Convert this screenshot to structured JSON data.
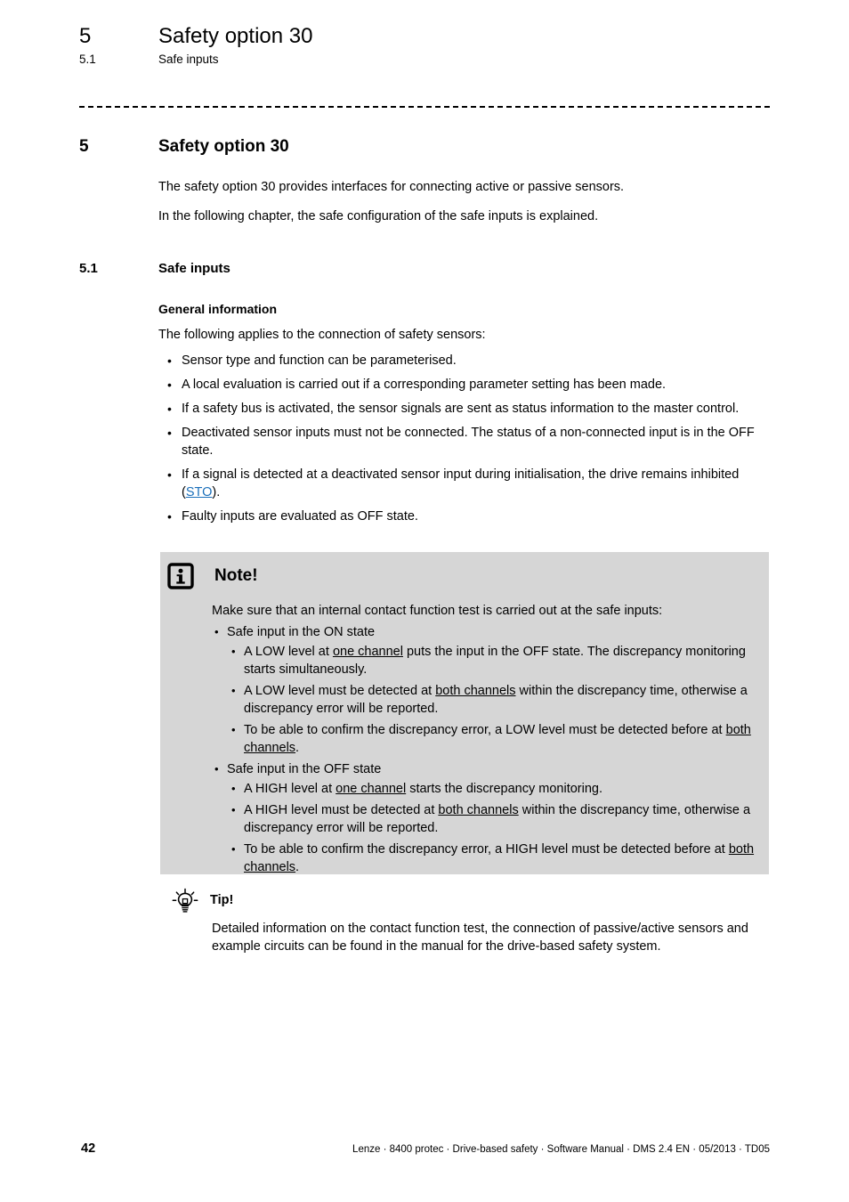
{
  "running_header": {
    "chapter_number": "5",
    "chapter_title": "Safety option 30",
    "section_number": "5.1",
    "section_title": "Safe inputs"
  },
  "chapter": {
    "number": "5",
    "title": "Safety option 30",
    "intro_paragraph_1": "The safety option 30 provides interfaces for connecting active or passive sensors.",
    "intro_paragraph_2": "In the following chapter, the safe configuration of the safe inputs is explained."
  },
  "section": {
    "number": "5.1",
    "title": "Safe inputs"
  },
  "general_information": {
    "title": "General information",
    "lead": "The following applies to the connection of safety sensors:",
    "bullets": [
      "Sensor type and function can be parameterised.",
      "A local evaluation is carried out if a corresponding parameter setting has been made.",
      "If a safety bus is activated, the sensor signals are sent as status information to the master control.",
      "Deactivated sensor inputs must not be connected. The status of a non-connected input is in the OFF state.",
      "Faulty inputs are evaluated as OFF state.",
      "If a signal is detected at a deactivated sensor input during initialisation, the drive remains inhibited ("
    ],
    "sto_bullet": {
      "text_before": "If a signal is detected at a deactivated sensor input during initialisation, the drive remains inhibited (",
      "link_label": "STO",
      "text_after": ")."
    }
  },
  "note": {
    "icon": "info-icon",
    "title": "Note!",
    "lead": "Make sure that an internal contact function test is carried out at the safe inputs:",
    "groups": [
      {
        "label": "Safe input in the ON state",
        "items": [
          {
            "prefix": "A LOW level at ",
            "underlined": "one channel",
            "suffix": " puts the input in the OFF state. The discrepancy monitoring starts simultaneously."
          },
          {
            "prefix": "A LOW level must be detected at ",
            "underlined": "both channels",
            "suffix": " within the discrepancy time, otherwise a discrepancy error will be reported."
          },
          {
            "prefix": "To be able to confirm the discrepancy error, a LOW level must be detected before at ",
            "underlined": "both channels",
            "suffix": "."
          }
        ]
      },
      {
        "label": "Safe input in the OFF state",
        "items": [
          {
            "prefix": "A HIGH level at ",
            "underlined": "one channel",
            "suffix": " starts the discrepancy monitoring."
          },
          {
            "prefix": "A HIGH level must be detected at ",
            "underlined": "both channels",
            "suffix": " within the discrepancy time, otherwise a discrepancy error will be reported."
          },
          {
            "prefix": "To be able to confirm the discrepancy error, a HIGH level must be detected before at ",
            "underlined": "both channels",
            "suffix": "."
          }
        ]
      }
    ],
    "background_color": "#d6d6d6"
  },
  "tip": {
    "icon": "lightbulb-icon",
    "title": "Tip!",
    "body": "Detailed information on the contact function test, the connection of passive/active sensors and example circuits can be found in the manual for the drive-based safety system."
  },
  "footer": {
    "page_number": "42",
    "text": "Lenze · 8400 protec · Drive-based safety · Software Manual · DMS 2.4 EN · 05/2013 · TD05"
  },
  "colors": {
    "link": "#1a6fba",
    "note_background": "#d6d6d6",
    "text": "#000000"
  }
}
